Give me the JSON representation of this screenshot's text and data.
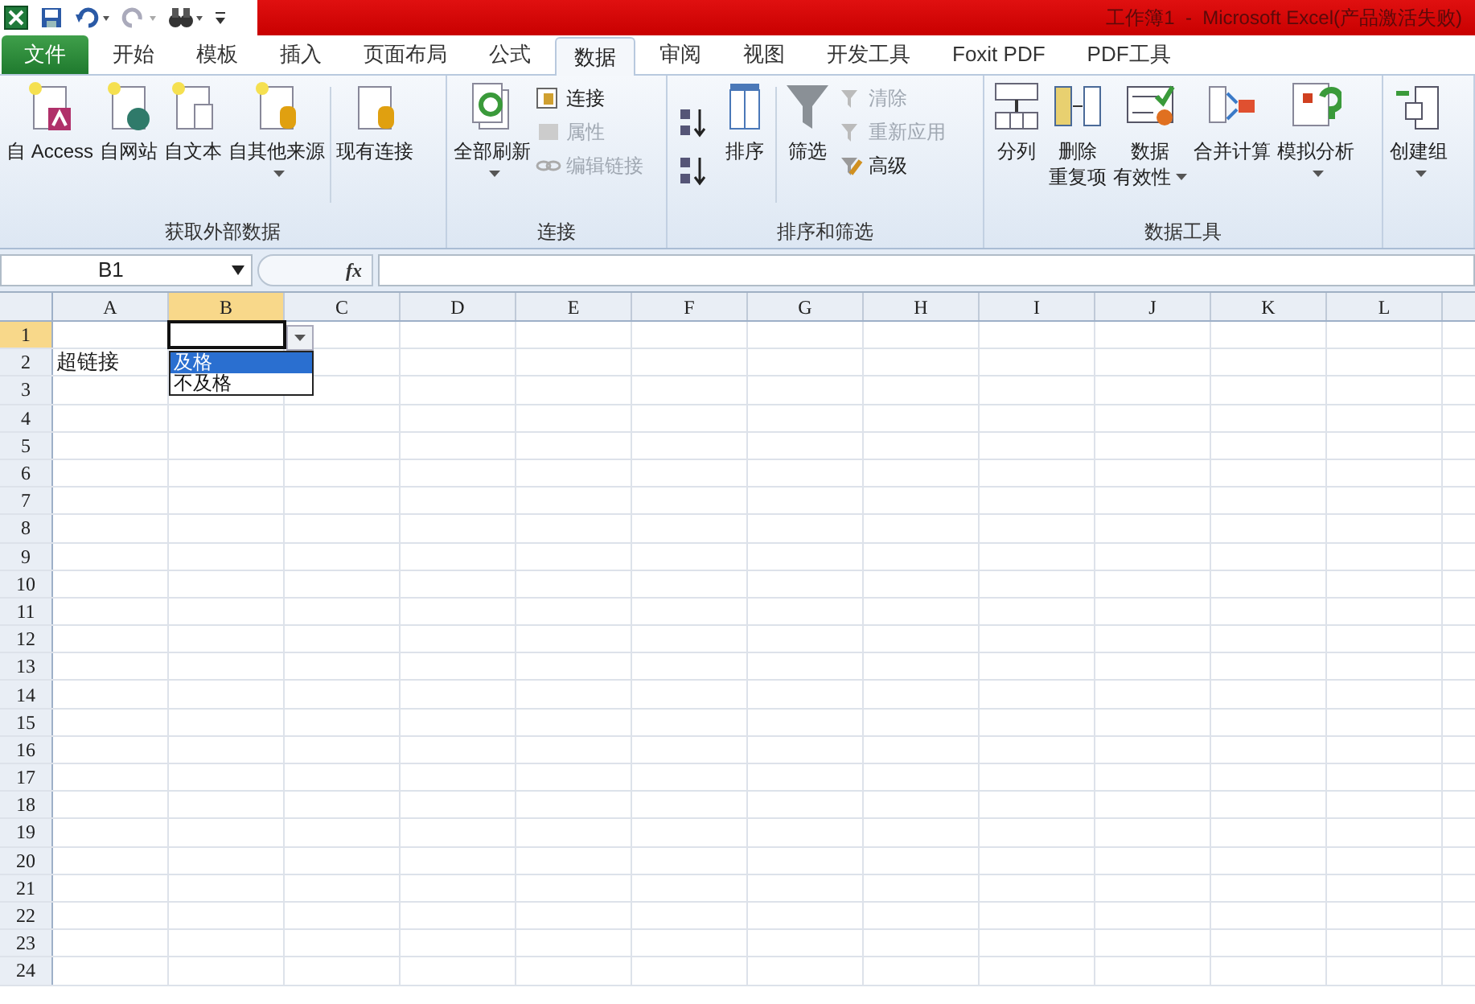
{
  "window": {
    "title": "工作簿1  -  Microsoft Excel(产品激活失败)"
  },
  "tabs": [
    {
      "label": "文件",
      "kind": "file",
      "selected": false
    },
    {
      "label": "开始",
      "selected": false
    },
    {
      "label": "模板",
      "selected": false
    },
    {
      "label": "插入",
      "selected": false
    },
    {
      "label": "页面布局",
      "selected": false
    },
    {
      "label": "公式",
      "selected": false
    },
    {
      "label": "数据",
      "selected": true
    },
    {
      "label": "审阅",
      "selected": false
    },
    {
      "label": "视图",
      "selected": false
    },
    {
      "label": "开发工具",
      "selected": false
    },
    {
      "label": "Foxit PDF",
      "selected": false
    },
    {
      "label": "PDF工具",
      "selected": false
    }
  ],
  "ribbon": {
    "groups": [
      {
        "label": "获取外部数据",
        "items": [
          {
            "kind": "large",
            "lines": [
              "自 Access"
            ]
          },
          {
            "kind": "large",
            "lines": [
              "自网站"
            ]
          },
          {
            "kind": "large",
            "lines": [
              "自文本"
            ]
          },
          {
            "kind": "large",
            "lines": [
              "自其他来源"
            ],
            "dropdown": true
          },
          {
            "kind": "separator"
          },
          {
            "kind": "large",
            "lines": [
              "现有连接"
            ]
          }
        ]
      },
      {
        "label": "连接",
        "items": [
          {
            "kind": "large",
            "lines": [
              "全部刷新"
            ],
            "dropdown": true
          },
          {
            "kind": "small",
            "entries": [
              {
                "label": "连接",
                "disabled": false
              },
              {
                "label": "属性",
                "disabled": true
              },
              {
                "label": "编辑链接",
                "disabled": true
              }
            ]
          }
        ]
      },
      {
        "label": "排序和筛选",
        "items": [
          {
            "kind": "sort_pair"
          },
          {
            "kind": "large",
            "lines": [
              "排序"
            ]
          },
          {
            "kind": "separator"
          },
          {
            "kind": "large",
            "lines": [
              "筛选"
            ]
          },
          {
            "kind": "small",
            "entries": [
              {
                "label": "清除",
                "disabled": true
              },
              {
                "label": "重新应用",
                "disabled": true
              },
              {
                "label": "高级",
                "disabled": false
              }
            ]
          }
        ]
      },
      {
        "label": "数据工具",
        "items": [
          {
            "kind": "large",
            "lines": [
              "分列"
            ]
          },
          {
            "kind": "large",
            "lines": [
              "删除",
              "重复项"
            ]
          },
          {
            "kind": "large",
            "lines": [
              "数据",
              "有效性"
            ],
            "dropdown": true
          },
          {
            "kind": "large",
            "lines": [
              "合并计算"
            ]
          },
          {
            "kind": "large",
            "lines": [
              "模拟分析"
            ],
            "dropdown": true
          }
        ]
      },
      {
        "items": [
          {
            "kind": "large",
            "lines": [
              "创建组"
            ],
            "dropdown": true
          }
        ]
      }
    ]
  },
  "formula_bar": {
    "name_box": "B1",
    "fx_label": "fx"
  },
  "sheet": {
    "columns": [
      {
        "label": "A",
        "selected": false
      },
      {
        "label": "B",
        "selected": true
      },
      {
        "label": "C",
        "selected": false
      },
      {
        "label": "D",
        "selected": false
      },
      {
        "label": "E",
        "selected": false
      },
      {
        "label": "F",
        "selected": false
      },
      {
        "label": "G",
        "selected": false
      },
      {
        "label": "H",
        "selected": false
      },
      {
        "label": "I",
        "selected": false
      },
      {
        "label": "J",
        "selected": false
      },
      {
        "label": "K",
        "selected": false
      },
      {
        "label": "L",
        "selected": false
      }
    ],
    "rows": [
      {
        "label": "1",
        "selected": true
      },
      {
        "label": "2",
        "selected": false,
        "cells": [
          "超链接"
        ]
      },
      {
        "label": "3",
        "selected": false
      },
      {
        "label": "4",
        "selected": false
      },
      {
        "label": "5",
        "selected": false
      },
      {
        "label": "6",
        "selected": false
      },
      {
        "label": "7",
        "selected": false
      },
      {
        "label": "8",
        "selected": false
      },
      {
        "label": "9",
        "selected": false
      },
      {
        "label": "10",
        "selected": false
      },
      {
        "label": "11",
        "selected": false
      },
      {
        "label": "12",
        "selected": false
      },
      {
        "label": "13",
        "selected": false
      },
      {
        "label": "14",
        "selected": false
      },
      {
        "label": "15",
        "selected": false
      },
      {
        "label": "16",
        "selected": false
      },
      {
        "label": "17",
        "selected": false
      },
      {
        "label": "18",
        "selected": false
      },
      {
        "label": "19",
        "selected": false
      },
      {
        "label": "20",
        "selected": false
      },
      {
        "label": "21",
        "selected": false
      },
      {
        "label": "22",
        "selected": false
      },
      {
        "label": "23",
        "selected": false
      },
      {
        "label": "24",
        "selected": false
      }
    ],
    "dropdown": {
      "options": [
        {
          "label": "及格",
          "selected": true
        },
        {
          "label": "不及格",
          "selected": false
        }
      ]
    }
  }
}
